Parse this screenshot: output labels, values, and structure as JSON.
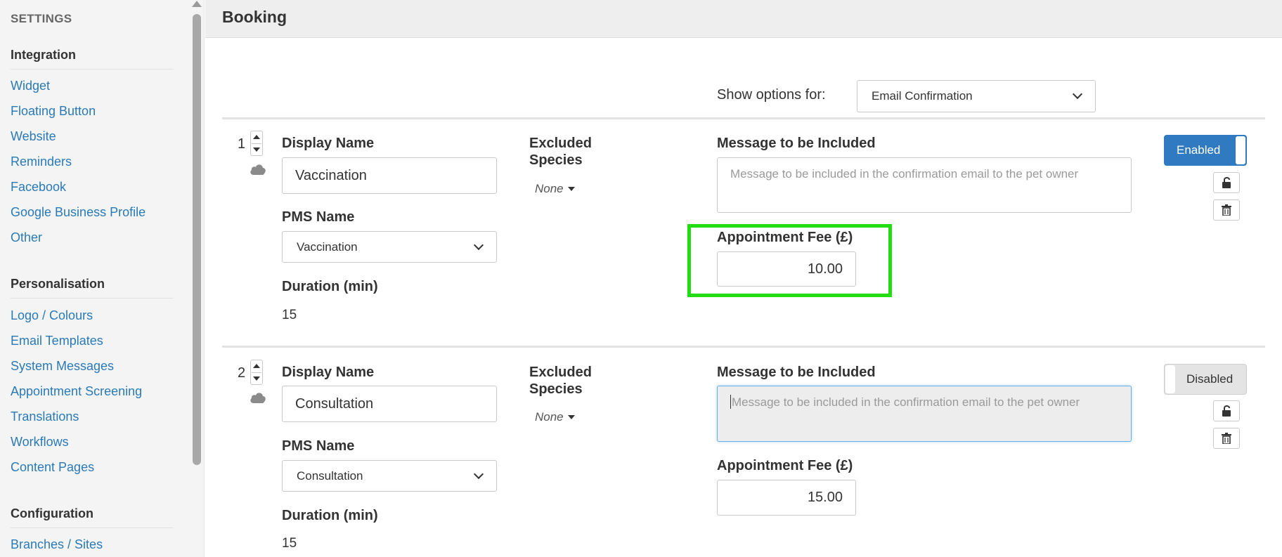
{
  "sidebar": {
    "heading": "SETTINGS",
    "sections": [
      {
        "title": "Integration",
        "items": [
          "Widget",
          "Floating Button",
          "Website",
          "Reminders",
          "Facebook",
          "Google Business Profile",
          "Other"
        ]
      },
      {
        "title": "Personalisation",
        "items": [
          "Logo / Colours",
          "Email Templates",
          "System Messages",
          "Appointment Screening",
          "Translations",
          "Workflows",
          "Content Pages"
        ]
      },
      {
        "title": "Configuration",
        "items": [
          "Branches / Sites"
        ]
      }
    ]
  },
  "header": {
    "title": "Booking"
  },
  "filter": {
    "label": "Show options for:",
    "selected": "Email Confirmation"
  },
  "colors": {
    "accent": "#2f7ac0",
    "link": "#2a7ab8",
    "highlight": "#22dd11"
  },
  "labels": {
    "display_name": "Display Name",
    "pms_name": "PMS Name",
    "duration": "Duration (min)",
    "excluded_species": "Excluded Species",
    "message": "Message to be Included",
    "fee": "Appointment Fee (£)"
  },
  "rows": [
    {
      "number": "1",
      "display_name": "Vaccination",
      "pms_name": "Vaccination",
      "duration": "15",
      "excluded_species": "None",
      "message_placeholder": "Message to be included in the confirmation email to the pet owner",
      "fee": "10.00",
      "status": "Enabled"
    },
    {
      "number": "2",
      "display_name": "Consultation",
      "pms_name": "Consultation",
      "duration": "15",
      "excluded_species": "None",
      "message_placeholder": "Message to be included in the confirmation email to the pet owner",
      "fee": "15.00",
      "status": "Disabled"
    }
  ],
  "icons": [
    "cloud-icon",
    "unlock-icon",
    "trash-icon",
    "chevron-down-icon",
    "caret-down-icon"
  ]
}
